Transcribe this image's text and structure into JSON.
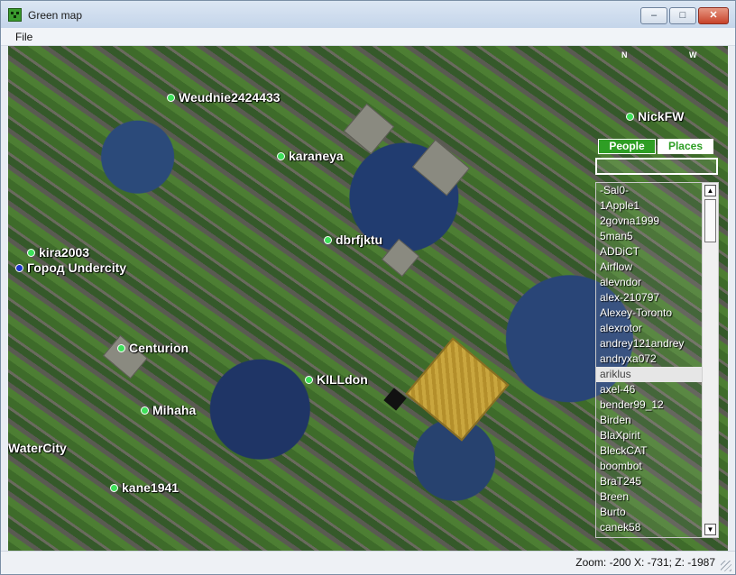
{
  "window": {
    "title": "Green map"
  },
  "menu": {
    "file": "File"
  },
  "window_buttons": {
    "minimize": "–",
    "maximize": "□",
    "close": "✕"
  },
  "map": {
    "markers": [
      {
        "name": "Weudnie2424433",
        "type": "player"
      },
      {
        "name": "karaneya",
        "type": "player"
      },
      {
        "name": "NickFW",
        "type": "player"
      },
      {
        "name": "kira2003",
        "type": "player"
      },
      {
        "name": "dbrfjktu",
        "type": "player"
      },
      {
        "name": "Город Undercity",
        "type": "place"
      },
      {
        "name": "Centurion",
        "type": "player"
      },
      {
        "name": "KILLdon",
        "type": "player"
      },
      {
        "name": "Mihaha",
        "type": "player"
      },
      {
        "name": "WaterCity",
        "type": "place"
      },
      {
        "name": "kane1941",
        "type": "player"
      }
    ],
    "compass": {
      "n": "N",
      "w": "W"
    }
  },
  "panel": {
    "tab_people": "People",
    "tab_places": "Places",
    "search_value": "",
    "people": [
      "-Sal0-",
      "1Apple1",
      "2govna1999",
      "5man5",
      "ADDiCT",
      "Airflow",
      "alevndor",
      "alex-210797",
      "Alexey-Toronto",
      "alexrotor",
      "andrey121andrey",
      "andryxa072",
      "ariklus",
      "axel-46",
      "bender99_12",
      "Birden",
      "BlaXpirit",
      "BleckCAT",
      "boombot",
      "BraT245",
      "Breen",
      "Burto",
      "canek58"
    ],
    "selected": "ariklus",
    "scroll_up": "▲",
    "scroll_down": "▼"
  },
  "status": {
    "text": "Zoom: -200  X: -731; Z: -1987"
  }
}
